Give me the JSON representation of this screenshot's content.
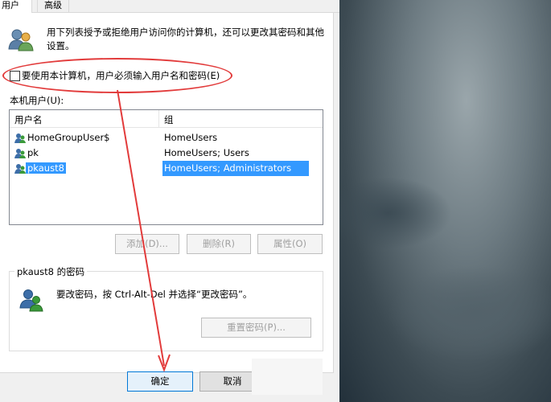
{
  "tabs": [
    "用户",
    "高级"
  ],
  "description": "用下列表授予或拒绝用户访问你的计算机，还可以更改其密码和其他设置。",
  "require_login_checkbox": {
    "label": "要使用本计算机，用户必须输入用户名和密码(E)",
    "checked": false
  },
  "local_users_label": "本机用户(U):",
  "table": {
    "columns": [
      "用户名",
      "组"
    ],
    "rows": [
      {
        "name": "HomeGroupUser$",
        "group": "HomeUsers",
        "selected": false
      },
      {
        "name": "pk",
        "group": "HomeUsers; Users",
        "selected": false
      },
      {
        "name": "pkaust8",
        "group": "HomeUsers; Administrators",
        "selected": true
      }
    ]
  },
  "buttons": {
    "add": "添加(D)...",
    "remove": "删除(R)",
    "properties": "属性(O)",
    "reset_password": "重置密码(P)...",
    "ok": "确定",
    "cancel": "取消"
  },
  "password_group": {
    "title": "pkaust8 的密码",
    "text": "要改密码，按 Ctrl-Alt-Del 并选择“更改密码”。"
  },
  "colors": {
    "selection": "#3399ff",
    "annotation": "#e23b3b"
  },
  "icons": [
    "users-icon",
    "user-icon",
    "password-user-icon"
  ]
}
